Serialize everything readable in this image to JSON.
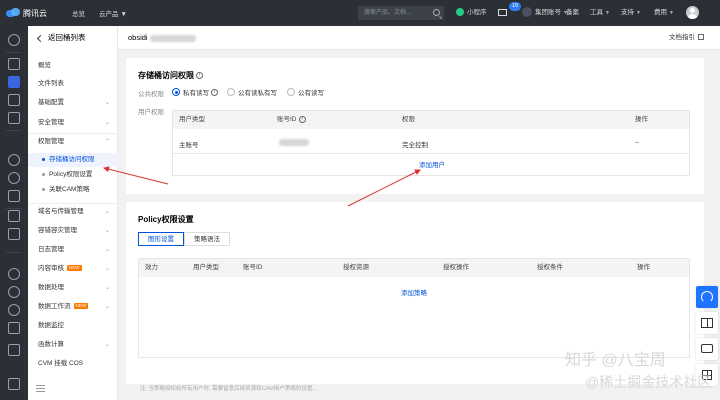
{
  "topbar": {
    "brand": "腾讯云",
    "nav": [
      "总览",
      "云产品"
    ],
    "search_placeholder": "搜索产品、文档...",
    "mini_program": "小程序",
    "mail_count": "19",
    "group_account": "集团账号",
    "record": "备案",
    "tools": "工具",
    "support": "支持",
    "billing": "费用"
  },
  "sidebar": {
    "back_label": "返回桶列表",
    "items": {
      "overview": "概览",
      "file_list": "文件列表",
      "basic_config": "基础配置",
      "security": "安全管理",
      "permissions": "权限管理",
      "bucket_acl": "存储桶访问权限",
      "policy": "Policy权限设置",
      "cam": "关联CAM策略",
      "domain": "域名与传输管理",
      "fault_tolerance": "容错容灾管理",
      "logs": "日志管理",
      "audit": "内容审核",
      "data_processing": "数据处理",
      "workflow": "数据工作流",
      "monitoring": "数据监控",
      "functions": "函数计算",
      "cvm_mount": "CVM 挂载 COS"
    },
    "new_tag": "NEW"
  },
  "header": {
    "bucket_name": "obsidi",
    "doc_guide": "文档指引"
  },
  "acl_card": {
    "title": "存储桶访问权限",
    "public_label": "公共权限",
    "options": [
      "私有读写",
      "公有读私有写",
      "公有读写"
    ],
    "user_label": "用户权限",
    "columns": [
      "用户类型",
      "账号ID",
      "权限",
      "操作"
    ],
    "row": {
      "type": "主账号",
      "permission": "完全控制",
      "action": "--"
    },
    "add_user": "添加用户"
  },
  "policy_card": {
    "title": "Policy权限设置",
    "tabs": [
      "图形设置",
      "策略语法"
    ],
    "columns": [
      "效力",
      "用户类型",
      "账号ID",
      "授权资源",
      "授权操作",
      "授权条件",
      "操作"
    ],
    "add_policy": "添加策略"
  },
  "footer_tip": "注: 当策略授权给所有用户时, 需要留意后续资源和CAM用户策略的设置...",
  "watermark": {
    "line1": "知乎 @八宝周",
    "line2": "@稀土掘金技术社区"
  },
  "colors": {
    "accent": "#0052d9",
    "topbar": "#2b2f36",
    "annotation_arrow": "#d9302b"
  }
}
